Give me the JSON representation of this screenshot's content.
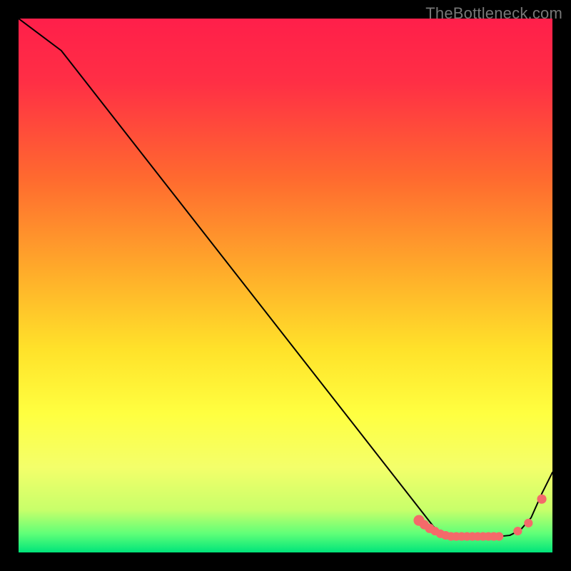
{
  "attribution": "TheBottleneck.com",
  "colors": {
    "frame": "#000000",
    "gradient_stops": [
      {
        "offset": 0.0,
        "color": "#ff1f4a"
      },
      {
        "offset": 0.12,
        "color": "#ff2f45"
      },
      {
        "offset": 0.3,
        "color": "#ff6a2f"
      },
      {
        "offset": 0.48,
        "color": "#ffae2a"
      },
      {
        "offset": 0.62,
        "color": "#ffe22a"
      },
      {
        "offset": 0.74,
        "color": "#ffff40"
      },
      {
        "offset": 0.84,
        "color": "#f4ff6a"
      },
      {
        "offset": 0.92,
        "color": "#c8ff6a"
      },
      {
        "offset": 0.965,
        "color": "#5fff78"
      },
      {
        "offset": 1.0,
        "color": "#00e47a"
      }
    ],
    "curve_stroke": "#000000",
    "marker_fill": "#f46a6a",
    "marker_stroke": "#f46a6a"
  },
  "chart_data": {
    "type": "line",
    "title": "",
    "xlabel": "",
    "ylabel": "",
    "xlim": [
      0,
      100
    ],
    "ylim": [
      0,
      100
    ],
    "grid": false,
    "legend": false,
    "description": "Bottleneck-style curve: value falls roughly linearly from ~100 at x≈0 to ~3 near x≈78, stays flat (~3) across a plateau to x≈90, then rises to ~15 at x=100. Pink markers sit along the plateau and the start of the rise.",
    "series": [
      {
        "name": "curve",
        "x": [
          0,
          4,
          8,
          78,
          80,
          82,
          84,
          86,
          88,
          90,
          92,
          94,
          96,
          98,
          100
        ],
        "y": [
          100,
          97,
          94,
          4.5,
          3.2,
          3.0,
          3.0,
          3.0,
          3.0,
          3.0,
          3.2,
          4.2,
          6.5,
          11,
          15
        ]
      }
    ],
    "markers": {
      "name": "highlight-points",
      "x": [
        75,
        76,
        77,
        78,
        79,
        80,
        81,
        82,
        83,
        84,
        85,
        86,
        87,
        88,
        89,
        90,
        93.5,
        95.5,
        98
      ],
      "y": [
        6.0,
        5.2,
        4.5,
        4.0,
        3.5,
        3.2,
        3.0,
        3.0,
        3.0,
        3.0,
        3.0,
        3.0,
        3.0,
        3.0,
        3.0,
        3.0,
        4.0,
        5.5,
        10.0
      ],
      "r": [
        7,
        6,
        6,
        5.5,
        5.5,
        5.5,
        5.5,
        5.5,
        5.5,
        5.5,
        5.5,
        5.5,
        5.5,
        5.5,
        5.5,
        5.5,
        5.5,
        5.5,
        6
      ]
    }
  }
}
